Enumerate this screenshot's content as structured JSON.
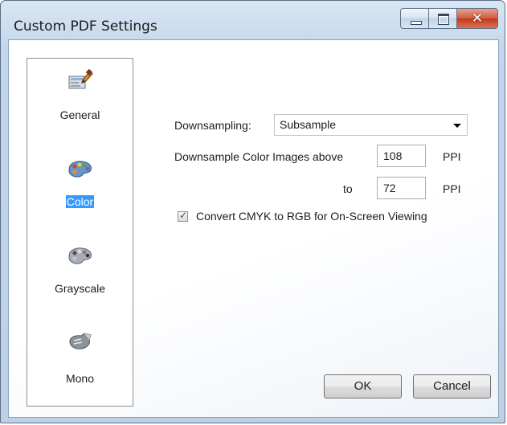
{
  "window": {
    "title": "Custom PDF Settings",
    "controls": [
      "minimize",
      "maximize",
      "close"
    ]
  },
  "sidebar": {
    "items": [
      {
        "label": "General",
        "icon": "general-settings-icon",
        "selected": false
      },
      {
        "label": "Color",
        "icon": "color-palette-icon",
        "selected": true
      },
      {
        "label": "Grayscale",
        "icon": "grayscale-palette-icon",
        "selected": false
      },
      {
        "label": "Mono",
        "icon": "mono-icon",
        "selected": false
      }
    ]
  },
  "settings": {
    "downsampling_label": "Downsampling:",
    "downsampling_value": "Subsample",
    "downsample_above_label": "Downsample Color Images above",
    "downsample_above_value": "108",
    "downsample_above_unit": "PPI",
    "to_label": "to",
    "to_value": "72",
    "to_unit": "PPI",
    "convert_label": "Convert CMYK to RGB for On-Screen Viewing",
    "convert_checked": true
  },
  "buttons": {
    "ok": "OK",
    "cancel": "Cancel"
  },
  "colors": {
    "selection": "#3399ff",
    "close_button": "#c2391c",
    "frame": "#bdd1e6"
  }
}
